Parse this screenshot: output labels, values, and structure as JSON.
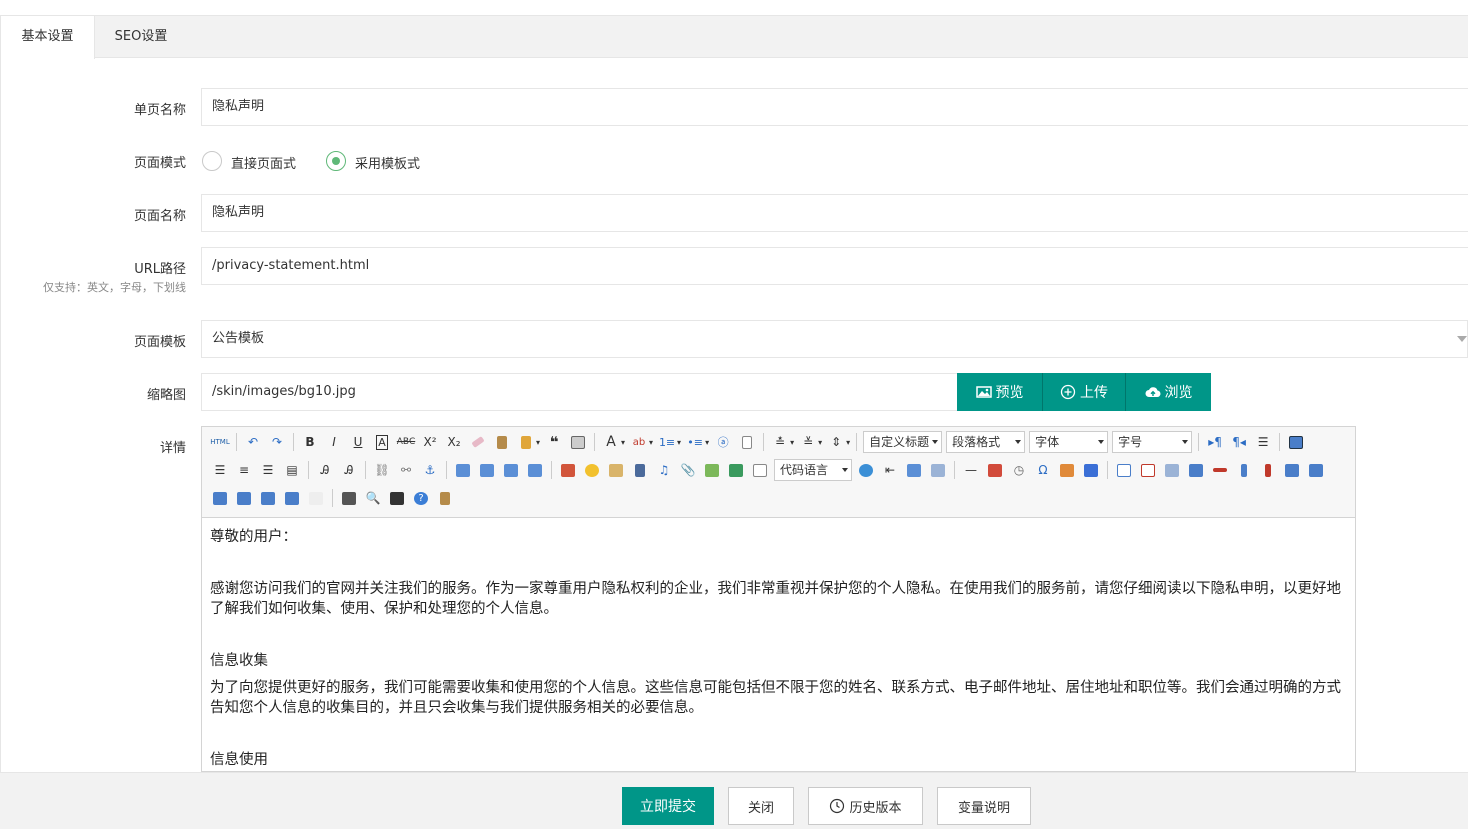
{
  "tabs": [
    {
      "label": "基本设置",
      "active": true
    },
    {
      "label": "SEO设置",
      "active": false
    }
  ],
  "form": {
    "page_name": {
      "label": "单页名称",
      "value": "隐私声明"
    },
    "page_mode": {
      "label": "页面模式",
      "options": [
        {
          "label": "直接页面式",
          "checked": false
        },
        {
          "label": "采用模板式",
          "checked": true
        }
      ]
    },
    "page_title": {
      "label": "页面名称",
      "value": "隐私声明"
    },
    "url_path": {
      "label": "URL路径",
      "hint": "仅支持：英文，字母，下划线",
      "value": "/privacy-statement.html"
    },
    "template": {
      "label": "页面模板",
      "value": "公告模板"
    },
    "thumbnail": {
      "label": "缩略图",
      "value": "/skin/images/bg10.jpg",
      "buttons": {
        "preview": "预览",
        "upload": "上传",
        "browse": "浏览"
      }
    },
    "detail": {
      "label": "详情"
    }
  },
  "editor": {
    "toolbar": {
      "html_label": "HTML",
      "custom_heading": "自定义标题",
      "paragraph_format": "段落格式",
      "font_family": "字体",
      "font_size": "字号",
      "code_language": "代码语言"
    },
    "content": {
      "greeting": "尊敬的用户：",
      "intro": "感谢您访问我们的官网并关注我们的服务。作为一家尊重用户隐私权利的企业，我们非常重视并保护您的个人隐私。在使用我们的服务前，请您仔细阅读以下隐私申明，以更好地了解我们如何收集、使用、保护和处理您的个人信息。",
      "section1_title": "信息收集",
      "section1_body": "为了向您提供更好的服务，我们可能需要收集和使用您的个人信息。这些信息可能包括但不限于您的姓名、联系方式、电子邮件地址、居住地址和职位等。我们会通过明确的方式告知您个人信息的收集目的，并且只会收集与我们提供服务相关的必要信息。",
      "section2_title": "信息使用"
    }
  },
  "footer": {
    "submit": "立即提交",
    "close": "关闭",
    "history": "历史版本",
    "variables": "变量说明"
  },
  "colors": {
    "primary": "#009688",
    "radio_checked": "#5fb878"
  }
}
